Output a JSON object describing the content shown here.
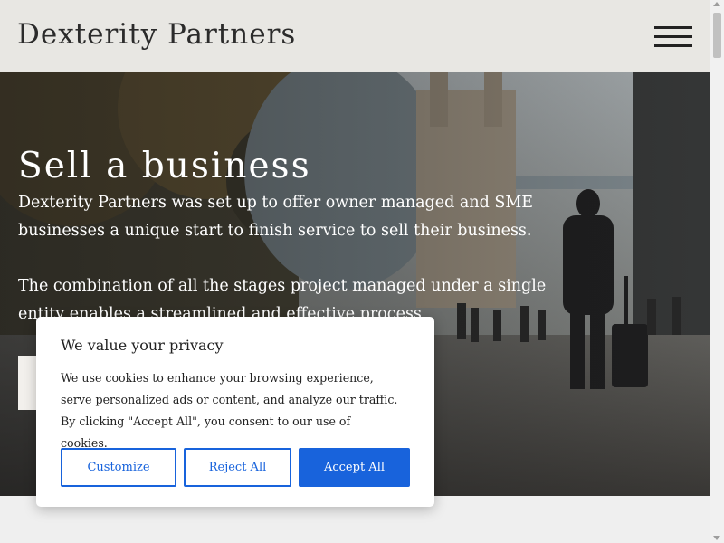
{
  "header": {
    "brand": "Dexterity Partners",
    "menu_icon": "hamburger-menu-icon"
  },
  "hero": {
    "title": "Sell a business",
    "paragraph_1": "Dexterity Partners was set up to offer owner managed and SME businesses a unique start to finish service to sell their business.",
    "paragraph_2": "The combination of all the stages project managed under a single entity enables a streamlined and effective process."
  },
  "cookie_banner": {
    "title": "We value your privacy",
    "text": "We use cookies to enhance your browsing experience, serve personalized ads or content, and analyze our traffic. By clicking \"Accept All\", you consent to our use of cookies.",
    "customize_label": "Customize",
    "reject_label": "Reject All",
    "accept_label": "Accept All",
    "accent_color": "#1863dc"
  }
}
